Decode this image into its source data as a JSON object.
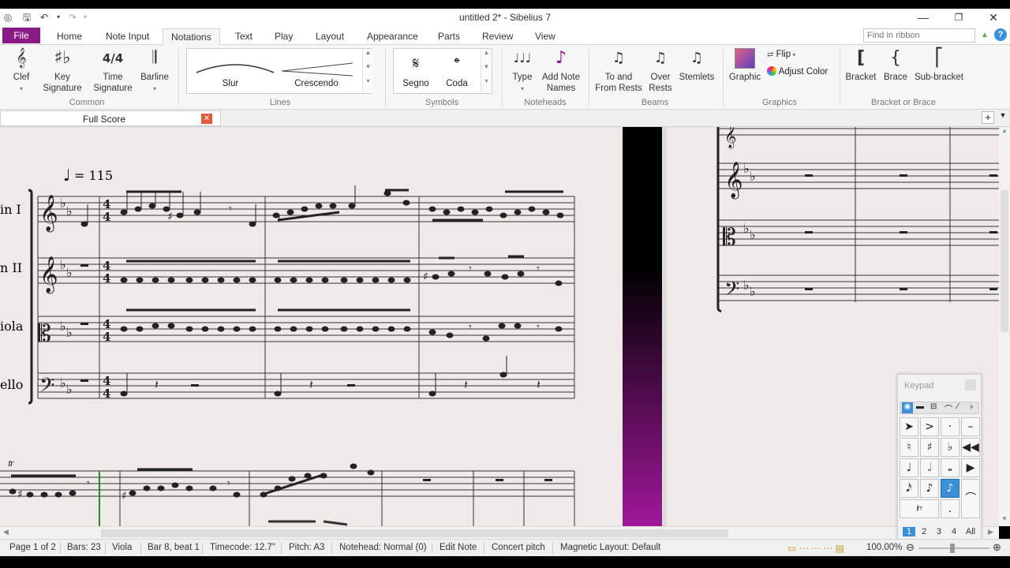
{
  "window": {
    "title": "untitled 2* - Sibelius 7",
    "controls": [
      "minimize",
      "restore",
      "close"
    ]
  },
  "ribbon_tabs": [
    "File",
    "Home",
    "Note Input",
    "Notations",
    "Text",
    "Play",
    "Layout",
    "Appearance",
    "Parts",
    "Review",
    "View"
  ],
  "active_tab": "Notations",
  "ribbon_search_placeholder": "Find in ribbon",
  "ribbon": {
    "common": {
      "label": "Common",
      "buttons": [
        "Clef",
        "Key\nSignature",
        "Time\nSignature",
        "Barline"
      ]
    },
    "lines": {
      "label": "Lines",
      "items": [
        "Slur",
        "Crescendo"
      ]
    },
    "symbols": {
      "label": "Symbols",
      "items": [
        "Segno",
        "Coda"
      ]
    },
    "noteheads": {
      "label": "Noteheads",
      "buttons": [
        "Type",
        "Add Note\nNames"
      ]
    },
    "beams": {
      "label": "Beams",
      "buttons": [
        "To and\nFrom Rests",
        "Over\nRests",
        "Stemlets"
      ]
    },
    "graphics": {
      "label": "Graphics",
      "buttons": [
        "Graphic",
        "Flip",
        "Adjust Color"
      ]
    },
    "bracket": {
      "label": "Bracket or Brace",
      "buttons": [
        "Bracket",
        "Brace",
        "Sub-bracket"
      ]
    }
  },
  "document_tab": "Full Score",
  "score": {
    "tempo_text": "= 115",
    "instrument_labels": [
      "in I",
      "n II",
      "iola",
      "ello"
    ],
    "page_color": "#efe9e7"
  },
  "keypad": {
    "title": "Keypad",
    "layouts": [
      "1",
      "2",
      "3",
      "4",
      "All"
    ],
    "active_layout": "1"
  },
  "status_bar": {
    "page": "Page 1 of 2",
    "bars": "Bars: 23",
    "instrument": "Viola",
    "position": "Bar 8, beat 1",
    "timecode": "Timecode: 12.7\"",
    "pitch": "Pitch: A3",
    "notehead": "Notehead: Normal (0)",
    "mode": "Edit Note",
    "concert": "Concert pitch",
    "magnetic": "Magnetic Layout: Default",
    "zoom": "100.00%"
  },
  "colors": {
    "file_tab": "#8a1a86",
    "accent": "#3a8fd8",
    "page_divider_gradient_end": "#a0189a"
  }
}
